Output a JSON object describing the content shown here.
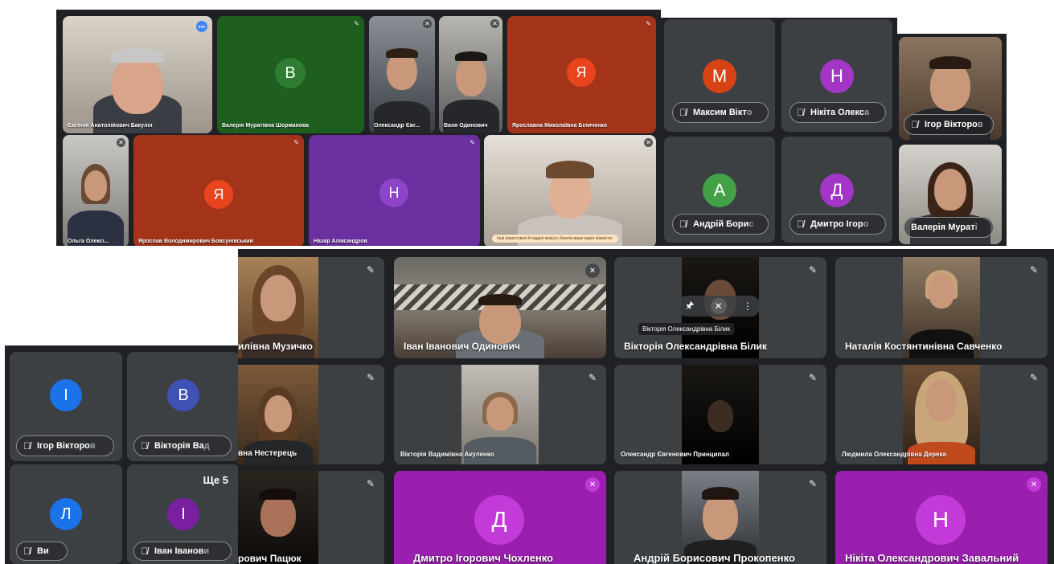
{
  "grid_top_left": {
    "tiles": [
      {
        "name": "Євгеній Анатолійович Бакулін"
      },
      {
        "name": "Валерія Муратівна Шорманова",
        "initial": "В"
      },
      {
        "name": "Олександр Євг..."
      },
      {
        "name": "Ваня Одинович"
      },
      {
        "name": "Ярославна Миколаївна Біличенко",
        "initial": "Я"
      },
      {
        "name": "Ольга Олексі..."
      },
      {
        "name": "Ярослав Володимирович Бовсунівський",
        "initial": "Я"
      },
      {
        "name": "Назар Аліксандров",
        "initial": "Н"
      },
      {
        "notice": "Інші користувачі й надалі можуть бачити ваше відео повністю."
      }
    ]
  },
  "grid_top_right": {
    "tiles": [
      {
        "initial": "М",
        "name": "Максим Вікт",
        "name_fade": "о"
      },
      {
        "initial": "Н",
        "name": "Нікіта Олекс",
        "name_fade": "а"
      },
      {
        "name": "Ігор Вікторо",
        "name_fade": "в"
      },
      {
        "initial": "А",
        "name": "Андрій Бори",
        "name_fade": "с"
      },
      {
        "initial": "Д",
        "name": "Дмитро Ігор",
        "name_fade": "о"
      },
      {
        "name": "Валерія Мурат",
        "name_fade": "і"
      }
    ]
  },
  "grid_bottom_left": {
    "tiles": [
      {
        "initial": "І",
        "name": "Ігор Вікторо",
        "name_fade": "в"
      },
      {
        "initial": "В",
        "name": "Вікторія Ва",
        "name_fade": "д"
      },
      {
        "initial": "Л",
        "name": "Ви"
      },
      {
        "initial": "І",
        "name": "Іван Іванов",
        "name_fade": "и",
        "more": "Ще 5"
      }
    ]
  },
  "grid_main": {
    "tiles": [
      {
        "name": "илівна Музичко"
      },
      {
        "name": "Іван Іванович Одинович"
      },
      {
        "name": "Вікторія Олександрівна Білик",
        "tooltip": "Вікторія Олександрівна Білик"
      },
      {
        "name": "Наталія Костянтинівна Савченко"
      },
      {
        "name": "вна Нестерець"
      },
      {
        "name": "Вікторія Вадимівна Акуленко"
      },
      {
        "name": "Олександр Євгенович Принципал"
      },
      {
        "name": "Людмила Олександрівна Дерека"
      },
      {
        "name": "рович Пацюк"
      },
      {
        "name": "Дмитро Ігорович Чохленко",
        "initial": "Д"
      },
      {
        "name": "Андрій Борисович Прокопенко"
      },
      {
        "name": "Нікіта Олександрович Завальний",
        "initial": "Н"
      }
    ]
  },
  "icons": {
    "mic_off": "🎙̸",
    "more": "⋮",
    "pin": "📌"
  },
  "colors": {
    "panel_bg": "#202124",
    "tile_bg": "#3c4043",
    "green": "#1e5e1e",
    "orange_tile": "#a3341a",
    "orange_avatar": "#e8441e",
    "purple_tile": "#6b2fa0",
    "magenta_tile": "#9a1fae",
    "magenta_avatar": "#c23ad8",
    "blue_avatar": "#1a73e8"
  }
}
